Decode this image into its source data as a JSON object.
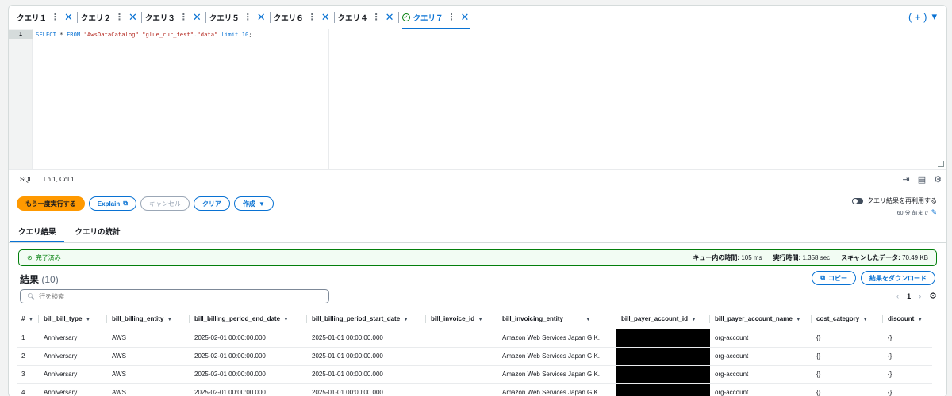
{
  "tabs": [
    {
      "label": "クエリ１",
      "active": false
    },
    {
      "label": "クエリ２",
      "active": false
    },
    {
      "label": "クエリ３",
      "active": false
    },
    {
      "label": "クエリ５",
      "active": false
    },
    {
      "label": "クエリ６",
      "active": false
    },
    {
      "label": "クエリ４",
      "active": false
    },
    {
      "label": "クエリ７",
      "active": true
    }
  ],
  "editor": {
    "line_number": "1",
    "sql": {
      "kw1": "SELECT",
      "star": " * ",
      "kw2": "FROM",
      "s1": " \"AwsDataCatalog\"",
      "dot1": ".",
      "s2": "\"glue_cur_test\"",
      "dot2": ".",
      "s3": "\"data\"",
      "kw3": " limit ",
      "n": "10",
      "semi": ";"
    }
  },
  "statusbar": {
    "lang": "SQL",
    "position": "Ln 1, Col 1"
  },
  "actions": {
    "rerun": "もう一度実行する",
    "explain": "Explain",
    "cancel": "キャンセル",
    "clear": "クリア",
    "create": "作成"
  },
  "reuse": {
    "label": "クエリ結果を再利用する",
    "sub": "60 分 前まで"
  },
  "result_tabs": [
    "クエリ結果",
    "クエリの統計"
  ],
  "banner": {
    "status": "完了済み",
    "queue_label": "キュー内の時間:",
    "queue_value": "105 ms",
    "exec_label": "実行時間:",
    "exec_value": "1.358 sec",
    "scan_label": "スキャンしたデータ:",
    "scan_value": "70.49 KB"
  },
  "results": {
    "title": "結果",
    "count": "(10)",
    "copy": "コピー",
    "download": "結果をダウンロード",
    "search_placeholder": "行を検索",
    "page": "1"
  },
  "table": {
    "columns": [
      "#",
      "bill_bill_type",
      "bill_billing_entity",
      "bill_billing_period_end_date",
      "bill_billing_period_start_date",
      "bill_invoice_id",
      "bill_invoicing_entity",
      "bill_payer_account_id",
      "bill_payer_account_name",
      "cost_category",
      "discount"
    ],
    "rows": [
      [
        "1",
        "Anniversary",
        "AWS",
        "2025-02-01 00:00:00.000",
        "2025-01-01 00:00:00.000",
        "",
        "Amazon Web Services Japan G.K.",
        "",
        "org-account",
        "{}",
        "{}"
      ],
      [
        "2",
        "Anniversary",
        "AWS",
        "2025-02-01 00:00:00.000",
        "2025-01-01 00:00:00.000",
        "",
        "Amazon Web Services Japan G.K.",
        "",
        "org-account",
        "{}",
        "{}"
      ],
      [
        "3",
        "Anniversary",
        "AWS",
        "2025-02-01 00:00:00.000",
        "2025-01-01 00:00:00.000",
        "",
        "Amazon Web Services Japan G.K.",
        "",
        "org-account",
        "{}",
        "{}"
      ],
      [
        "4",
        "Anniversary",
        "AWS",
        "2025-02-01 00:00:00.000",
        "2025-01-01 00:00:00.000",
        "",
        "Amazon Web Services Japan G.K.",
        "",
        "org-account",
        "{}",
        "{}"
      ]
    ]
  }
}
